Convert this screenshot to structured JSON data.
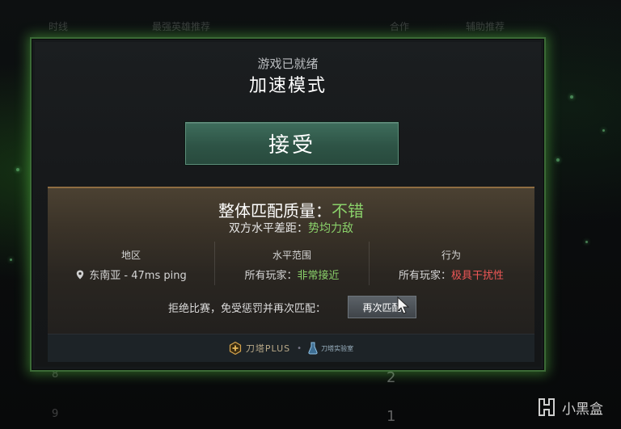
{
  "dialog": {
    "status": "游戏已就绪",
    "mode": "加速模式",
    "accept_label": "接受"
  },
  "quality": {
    "label": "整体匹配质量：",
    "value": "不错",
    "gap_label": "双方水平差距：",
    "gap_value": "势均力敌",
    "stats": [
      {
        "title": "地区",
        "value": "东南亚 - 47ms ping"
      },
      {
        "title": "水平范围",
        "prefix": "所有玩家：",
        "value": "非常接近"
      },
      {
        "title": "行为",
        "prefix": "所有玩家：",
        "value": "极具干扰性"
      }
    ],
    "decline_text": "拒绝比赛，免受惩罚并再次匹配：",
    "requeue_label": "再次匹配"
  },
  "footer": {
    "plus_label": "刀塔PLUS",
    "separator": "•",
    "lab_label": "刀塔实验室"
  },
  "background": {
    "headers": [
      "时线",
      "最强英雄推荐",
      "合作",
      "辅助推荐"
    ],
    "row_numbers": [
      "8",
      "9"
    ],
    "big_numbers": [
      "2",
      "1"
    ]
  },
  "watermark": {
    "text": "小黑盒"
  },
  "colors": {
    "good": "#8ad16a",
    "bad": "#f05757",
    "accept": "#2e5446",
    "glow": "#5ac846"
  },
  "icons": [
    "location-pin-icon",
    "plus-icon",
    "lab-icon",
    "cursor-icon",
    "watermark-logo-icon"
  ]
}
